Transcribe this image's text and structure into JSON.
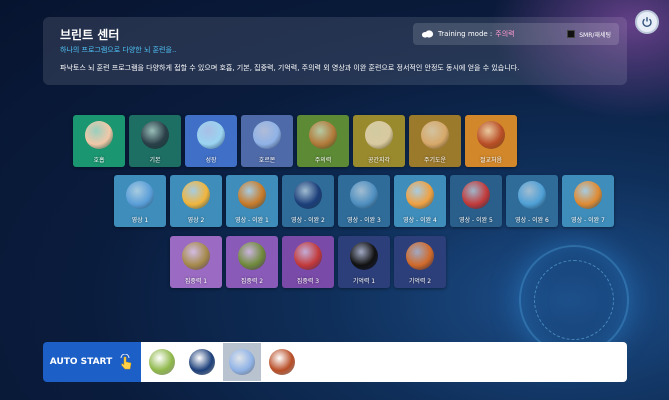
{
  "header": {
    "title": "브린트 센터",
    "subtitle": "하나의 프로그램으로 다양한 뇌 훈련을..",
    "description": "파낙토스 뇌 훈련 프로그램을 다양하게 접할 수 있으며 호흡, 기본, 집중력, 기억력, 주의력 외 영상과 이완 훈련으로 정서적인 안정도 동시에 얻을 수 있습니다.",
    "mode_label": "Training mode :",
    "mode_value": "주의력",
    "reset_label": "SMR/재세팅"
  },
  "tiles": {
    "row1": [
      {
        "label": "호흡",
        "bg": "#1a9670",
        "img": "#f2c8a8"
      },
      {
        "label": "기본",
        "bg": "#1d6e63",
        "img": "#2a3f48"
      },
      {
        "label": "성장",
        "bg": "#3f6fc6",
        "img": "#9ad4f0"
      },
      {
        "label": "호르몬",
        "bg": "#4f6aa8",
        "img": "#8fb2e6"
      },
      {
        "label": "주의력",
        "bg": "#5c8a35",
        "img": "#b27a3a"
      },
      {
        "label": "공간지각",
        "bg": "#9a8a2e",
        "img": "#d9c9a0"
      },
      {
        "label": "주기도운",
        "bg": "#9c7a2c",
        "img": "#d6a86a"
      },
      {
        "label": "절교처음",
        "bg": "#d2882a",
        "img": "#b84d26"
      }
    ],
    "row2": [
      {
        "label": "영상 1",
        "bg": "#3e8dbb",
        "img": "#5a9ed8"
      },
      {
        "label": "영상 2",
        "bg": "#3e8dbb",
        "img": "#f1b53b"
      },
      {
        "label": "영상 - 이완 1",
        "bg": "#3e8dbb",
        "img": "#c87a28"
      },
      {
        "label": "영상 - 이완 2",
        "bg": "#2f6c9a",
        "img": "#1c3f7a"
      },
      {
        "label": "영상 - 이완 3",
        "bg": "#2f6c9a",
        "img": "#4f8fc0"
      },
      {
        "label": "영상 - 이완 4",
        "bg": "#3e8dbb",
        "img": "#f0a040"
      },
      {
        "label": "영상 - 이완 5",
        "bg": "#2a5f8c",
        "img": "#c23a3a"
      },
      {
        "label": "영상 - 이완 6",
        "bg": "#2f6c9a",
        "img": "#4fa0d6"
      },
      {
        "label": "영상 - 이완 7",
        "bg": "#3e8dbb",
        "img": "#e08a30"
      }
    ],
    "row3": [
      {
        "label": "집중력 1",
        "bg": "#9b6bc3",
        "img": "#a58a4a"
      },
      {
        "label": "집중력 2",
        "bg": "#8a5ab8",
        "img": "#6f8a3a"
      },
      {
        "label": "집중력 3",
        "bg": "#7a4aa8",
        "img": "#c23a3a"
      },
      {
        "label": "기억력 1",
        "bg": "#2d3f7a",
        "img": "#111111"
      },
      {
        "label": "기억력 2",
        "bg": "#2d3f7a",
        "img": "#d06a2a"
      }
    ]
  },
  "bottom": {
    "auto_start_label": "AUTO START",
    "queue": [
      {
        "img": "#8fb84a",
        "dark": false
      },
      {
        "img": "#1c3f7a",
        "dark": false
      },
      {
        "img": "#8fb2e6",
        "dark": true
      },
      {
        "img": "#b84d26",
        "dark": false
      }
    ]
  }
}
